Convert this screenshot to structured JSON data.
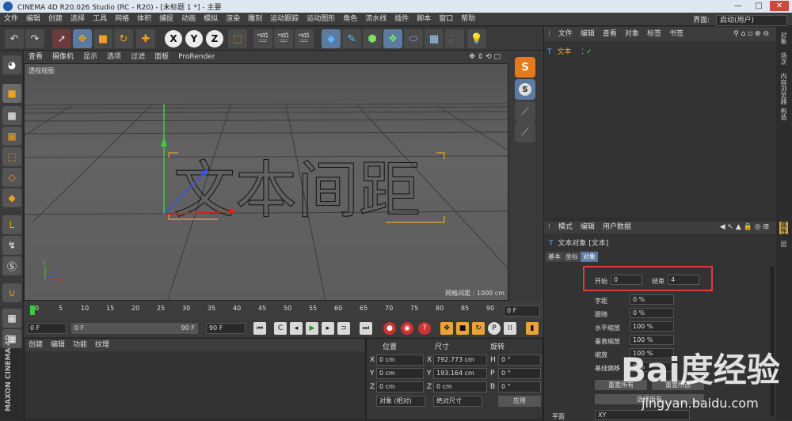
{
  "title": "CINEMA 4D R20.026 Studio (RC - R20) - [未标题 1 *] - 主要",
  "window_controls": {
    "min": "—",
    "max": "□",
    "close": "✕"
  },
  "menu": [
    "文件",
    "编辑",
    "创建",
    "选择",
    "工具",
    "网格",
    "体积",
    "捕捉",
    "动画",
    "模拟",
    "渲染",
    "雕刻",
    "运动跟踪",
    "运动图形",
    "角色",
    "流水线",
    "插件",
    "脚本",
    "窗口",
    "帮助"
  ],
  "interface": {
    "label": "界面:",
    "value": "启动(用户)"
  },
  "toolbar": {
    "undo": "↶",
    "redo": "↷",
    "x": "X",
    "y": "Y",
    "z": "Z"
  },
  "viewport": {
    "menu": [
      "查看",
      "摄像机",
      "显示",
      "选项",
      "过滤",
      "面板",
      "ProRender"
    ],
    "label": "透视视图",
    "text": "文本间距",
    "grid_info": "网格间距 : 1000 cm",
    "axis_x": "X",
    "axis_y": "Y",
    "axis_z": "Z"
  },
  "timeline": {
    "ticks": [
      "0",
      "5",
      "10",
      "15",
      "20",
      "25",
      "30",
      "35",
      "40",
      "45",
      "50",
      "55",
      "60",
      "65",
      "70",
      "75",
      "80",
      "85",
      "90"
    ],
    "end_field": "0 F"
  },
  "transport": {
    "start": "0 F",
    "current": "0 F",
    "range_end": "90 F",
    "end": "90 F"
  },
  "material": {
    "menu": [
      "创建",
      "编辑",
      "功能",
      "纹理"
    ]
  },
  "coords": {
    "headers": [
      "位置",
      "尺寸",
      "旋转"
    ],
    "rows": [
      {
        "axis": "X",
        "pos": "0 cm",
        "size_axis": "X",
        "size": "792.773 cm",
        "rot_axis": "H",
        "rot": "0 °"
      },
      {
        "axis": "Y",
        "pos": "0 cm",
        "size_axis": "Y",
        "size": "193.164 cm",
        "rot_axis": "P",
        "rot": "0 °"
      },
      {
        "axis": "Z",
        "pos": "0 cm",
        "size_axis": "Z",
        "size": "0 cm",
        "rot_axis": "B",
        "rot": "0 °"
      }
    ],
    "mode1": "对象 (相对)",
    "mode2": "绝对尺寸",
    "apply": "应用"
  },
  "branding": "MAXON CINEMA 4D",
  "object_manager": {
    "menu": [
      "文件",
      "编辑",
      "查看",
      "对象",
      "标签",
      "书签"
    ],
    "object": "文本"
  },
  "attributes": {
    "menu": [
      "模式",
      "编辑",
      "用户数据"
    ],
    "header": "文本对象 [文本]",
    "tabs": [
      "基本",
      "坐标",
      "对象"
    ],
    "start_label": "开始",
    "start_value": "0",
    "end_label": "结束",
    "end_value": "4",
    "params": [
      {
        "label": "字距",
        "value": "0 %"
      },
      {
        "label": "跟随",
        "value": "0 %"
      },
      {
        "label": "水平缩放",
        "value": "100 %"
      },
      {
        "label": "垂直缩放",
        "value": "100 %"
      },
      {
        "label": "缩放",
        "value": "100 %"
      },
      {
        "label": "基线偏移",
        "value": "0 %"
      }
    ],
    "btn_reset_all": "重置所有",
    "btn_reset_sel": "重置所选",
    "btn_select_all": "选择所有",
    "plane_label": "平面",
    "plane_value": "XY"
  },
  "side_tabs": [
    "对象",
    "场次",
    "内容浏览器",
    "构造",
    "属性",
    "层"
  ],
  "watermark": {
    "logo": "Bai度经验",
    "url": "jingyan.baidu.com"
  },
  "colors": {
    "accent_blue": "#5b7ca0",
    "highlight_red": "#e23b3b",
    "text_outline_orange": "#e8a33c"
  }
}
